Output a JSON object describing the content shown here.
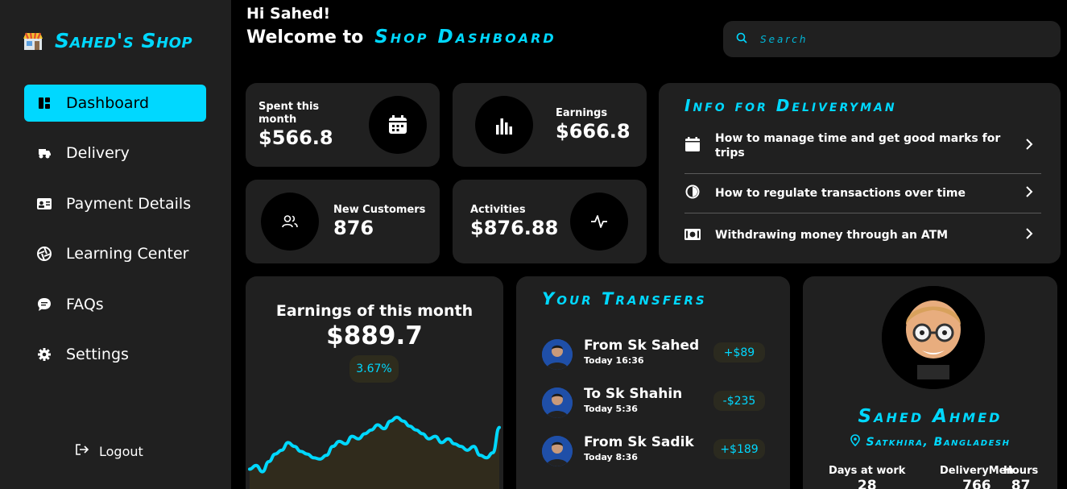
{
  "brand": {
    "name": "Sahed's Shop",
    "icon": "shop-icon"
  },
  "sidebar": {
    "items": [
      {
        "label": "Dashboard",
        "icon": "dashboard-icon",
        "active": true
      },
      {
        "label": "Delivery",
        "icon": "delivery-icon",
        "active": false
      },
      {
        "label": "Payment Details",
        "icon": "id-card-icon",
        "active": false
      },
      {
        "label": "Learning Center",
        "icon": "aperture-icon",
        "active": false
      },
      {
        "label": "FAQs",
        "icon": "chat-icon",
        "active": false
      },
      {
        "label": "Settings",
        "icon": "gear-icon",
        "active": false
      }
    ],
    "logout": "Logout"
  },
  "header": {
    "greeting": "Hi Sahed!",
    "welcome_prefix": "Welcome to",
    "welcome_accent": "Shop Dashboard",
    "search_placeholder": "Search"
  },
  "stats": {
    "spent": {
      "label": "Spent this month",
      "value": "$566.8"
    },
    "earnings": {
      "label": "Earnings",
      "value": "$666.8"
    },
    "customers": {
      "label": "New Customers",
      "value": "876"
    },
    "activities": {
      "label": "Activities",
      "value": "$876.88"
    }
  },
  "info": {
    "title": "Info for Deliveryman",
    "rows": [
      {
        "text": "How to manage time and get good marks for trips",
        "icon": "calendar-icon"
      },
      {
        "text": "How to regulate transactions over time",
        "icon": "clock-icon"
      },
      {
        "text": "Withdrawing money through an ATM",
        "icon": "cash-icon"
      }
    ]
  },
  "earnings_chart": {
    "title": "Earnings of this month",
    "value": "$889.7",
    "change": "3.67%"
  },
  "chart_data": {
    "type": "area",
    "x": [
      1,
      2,
      3,
      4,
      5,
      6,
      7,
      8,
      9,
      10,
      11,
      12,
      13,
      14,
      15,
      16,
      17,
      18,
      19,
      20,
      21,
      22,
      23,
      24,
      25,
      26,
      27,
      28,
      29,
      30,
      31,
      32,
      33,
      34,
      35,
      36,
      37,
      38,
      39,
      40
    ],
    "values": [
      22,
      25,
      20,
      28,
      34,
      37,
      43,
      40,
      36,
      34,
      31,
      30,
      33,
      40,
      44,
      42,
      48,
      46,
      50,
      53,
      57,
      54,
      60,
      63,
      60,
      56,
      53,
      50,
      46,
      48,
      43,
      46,
      42,
      40,
      37,
      40,
      33,
      31,
      35,
      55
    ],
    "color": "#00d8ff",
    "fill": "#302b1c"
  },
  "transfers": {
    "title": "Your Transfers",
    "items": [
      {
        "name": "From Sk Sahed",
        "time": "Today 16:36",
        "amount": "+$89"
      },
      {
        "name": "To Sk Shahin",
        "time": "Today 5:36",
        "amount": "-$235"
      },
      {
        "name": "From Sk Sadik",
        "time": "Today 8:36",
        "amount": "+$189"
      }
    ]
  },
  "profile": {
    "name": "Sahed Ahmed",
    "location": "Satkhira, Bangladesh",
    "stats": [
      {
        "label": "Days at work",
        "value": "28"
      },
      {
        "label": "DeliveryMen",
        "value": "766"
      },
      {
        "label": "Hours",
        "value": "87"
      }
    ]
  },
  "colors": {
    "accent": "#00d8ff",
    "card": "#202020",
    "background": "#000000"
  }
}
